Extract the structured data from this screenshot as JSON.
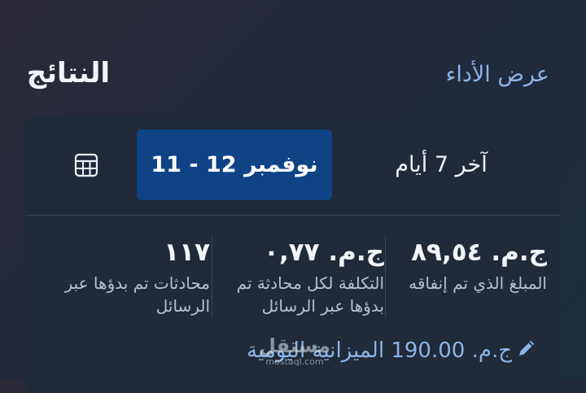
{
  "header": {
    "title": "النتائج",
    "performance_link": "عرض الأداء"
  },
  "date_filter": {
    "last_7_days": "آخر 7 أيام",
    "selected_range": "11 - 12 نوفمبر",
    "table_icon": "table-grid-icon"
  },
  "metrics": [
    {
      "value": "ج.م. ٨٩,٥٤",
      "label": "المبلغ الذي تم إنفاقه"
    },
    {
      "value": "ج.م. ٠,٧٧",
      "label": "التكلفة لكل محادثة تم بدؤها عبر الرسائل"
    },
    {
      "value": "١١٧",
      "label": "محادثات تم بدؤها عبر الرسائل"
    }
  ],
  "budget": {
    "text": "ج.م. 190.00 الميزانية اليومية",
    "icon": "pencil-icon"
  },
  "watermark": {
    "mark": "مستقل",
    "domain": "mostaql.com"
  },
  "colors": {
    "accent_link": "#8ab4e8",
    "selected_button": "#0f4386",
    "card_bg": "#202a38"
  }
}
